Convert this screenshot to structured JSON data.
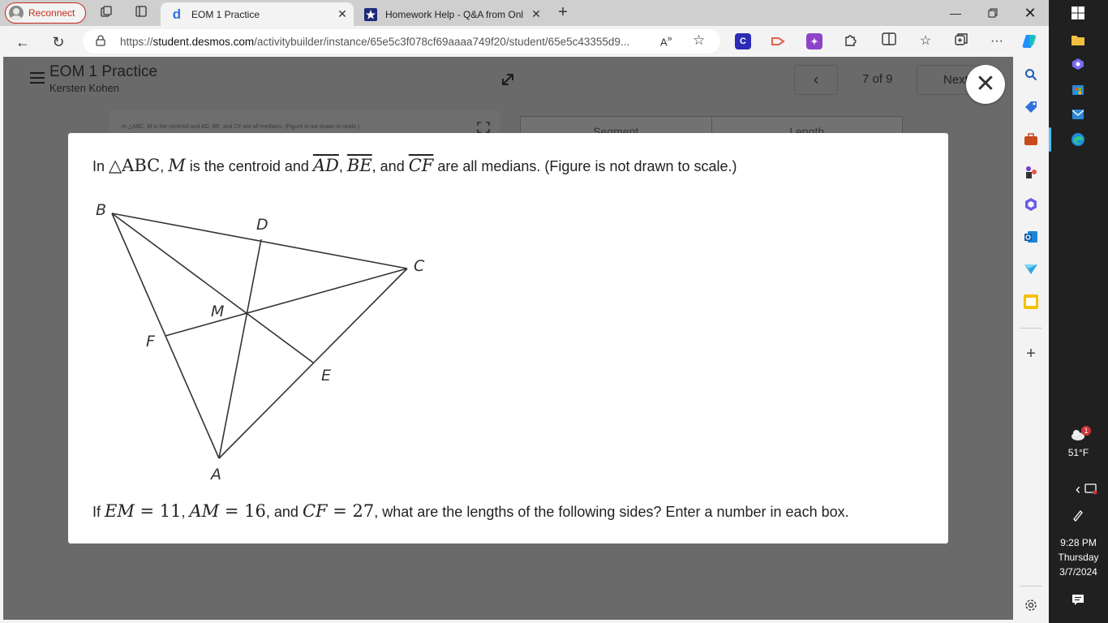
{
  "browser": {
    "reconnect_label": "Reconnect",
    "tabs": [
      {
        "title": "EOM 1 Practice"
      },
      {
        "title": "Homework Help - Q&A from Onl"
      }
    ],
    "url_prefix": "https://",
    "url_host": "student.desmos.com",
    "url_path": "/activitybuilder/instance/65e5c3f078cf69aaaa749f20/student/65e5c43355d9..."
  },
  "activity": {
    "title": "EOM 1 Practice",
    "student": "Kersten Kohen",
    "pager": "7 of 9",
    "next_label": "Next"
  },
  "background": {
    "small_text": "In △ABC, M is the centroid and AD, BE, and CF are all medians.  (Figure is not drawn to scale.)",
    "table_headers": [
      "Segment",
      "Length"
    ]
  },
  "modal": {
    "q1": {
      "in": "In ",
      "triangle": "△ABC",
      "comma1": ", ",
      "m": "M",
      "mid": " is the centroid and ",
      "ad": "AD",
      "sep1": ", ",
      "be": "BE",
      "sep2": ", and ",
      "cf": "CF",
      "tail": " are all medians.  (Figure is not drawn to scale.)"
    },
    "figure_labels": {
      "b": "B",
      "d": "D",
      "c": "C",
      "m": "M",
      "f": "F",
      "e": "E",
      "a": "A"
    },
    "q2": {
      "if": "If ",
      "em": "EM",
      "eq1": " = 11",
      "c1": ", ",
      "am": "AM",
      "eq2": " = 16",
      "c2": ", and ",
      "cf": "CF",
      "eq3": " = 27",
      "tail": ", what are the lengths of the following sides?  Enter a number in each box."
    }
  },
  "taskbar": {
    "weather_badge": "1",
    "temperature": "51°F",
    "time": "9:28 PM",
    "day": "Thursday",
    "date": "3/7/2024"
  },
  "colors": {
    "reconnect": "#c42b1c",
    "overlay": "#6a6a6a",
    "desmos_tab": "#2f72dc",
    "taskbar": "#202020"
  }
}
